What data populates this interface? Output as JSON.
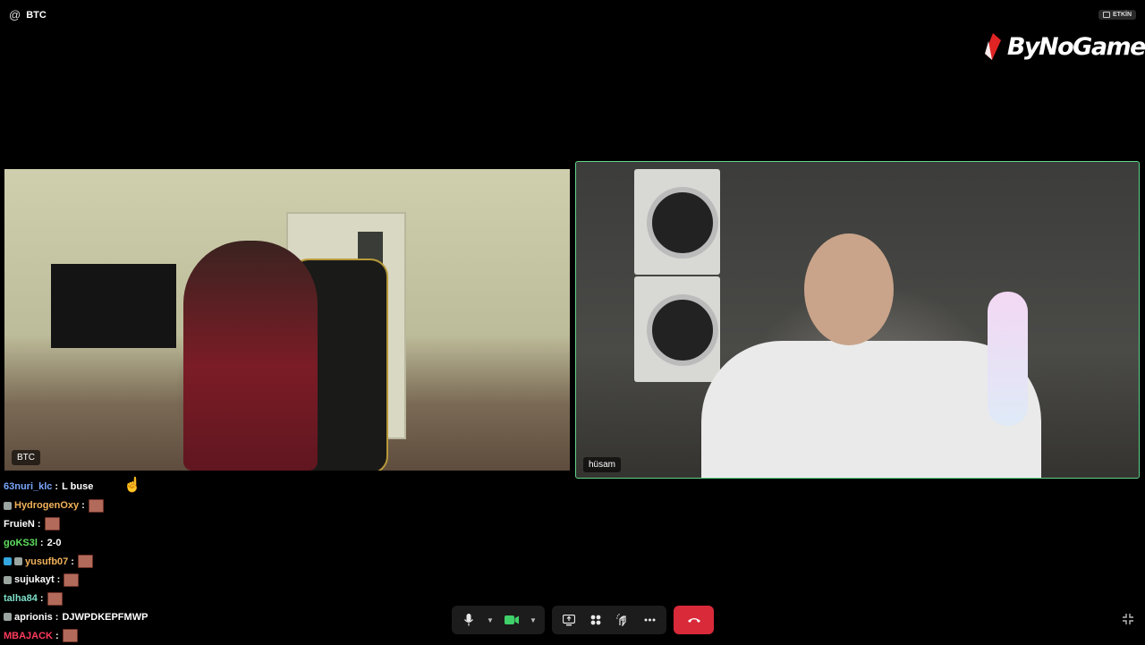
{
  "header": {
    "channel": "BTC",
    "status_badge": "ETKİN",
    "brand": "ByNoGame"
  },
  "tiles": [
    {
      "name": "BTC"
    },
    {
      "name": "hüsam"
    }
  ],
  "chat": [
    {
      "user": "63nuri_klc",
      "color": "#7aa7ff",
      "badges": 0,
      "text": "L buse",
      "emote": false
    },
    {
      "user": "HydrogenOxy",
      "color": "#f2b25a",
      "badges": 1,
      "text": "",
      "emote": true
    },
    {
      "user": "FruieN",
      "color": "#ffffff",
      "badges": 0,
      "text": "",
      "emote": true
    },
    {
      "user": "goKS3l",
      "color": "#5fe05f",
      "badges": 0,
      "text": "2-0",
      "emote": false
    },
    {
      "user": "yusufb07",
      "color": "#f2b25a",
      "badges": 2,
      "text": "",
      "emote": true
    },
    {
      "user": "sujukayt",
      "color": "#ffffff",
      "badges": 1,
      "text": "",
      "emote": true
    },
    {
      "user": "talha84",
      "color": "#7ee0c8",
      "badges": 0,
      "text": "",
      "emote": true
    },
    {
      "user": "aprionis",
      "color": "#ffffff",
      "badges": 1,
      "text": "DJWPDKEPFMWP",
      "emote": false
    },
    {
      "user": "MBAJACK",
      "color": "#ff3b5c",
      "badges": 0,
      "text": "",
      "emote": true
    }
  ],
  "controls": {
    "microphone": "microphone-icon",
    "camera": "camera-icon",
    "share_screen": "share-screen-icon",
    "activities": "grid-icon",
    "effects": "sparkle-hand-icon",
    "more": "more-icon",
    "hangup": "hangup-icon"
  },
  "colors": {
    "accent_border": "#5fd58a",
    "hangup": "#d92a3a",
    "camera_on": "#3fd06a"
  }
}
